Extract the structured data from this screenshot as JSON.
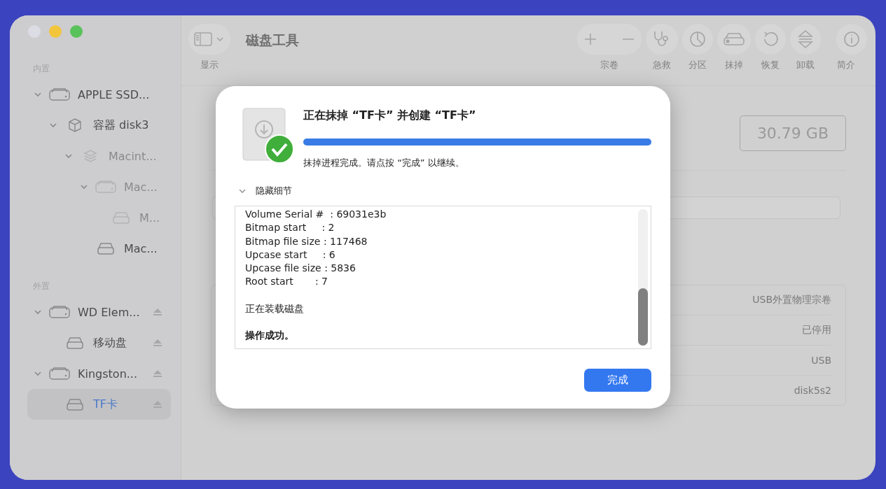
{
  "window": {
    "title": "磁盘工具"
  },
  "toolbar": {
    "view_button": {
      "label": "显示"
    },
    "buttons": [
      {
        "kind": "volume",
        "label": "宗卷"
      },
      {
        "kind": "first-aid",
        "label": "急救"
      },
      {
        "kind": "partition",
        "label": "分区"
      },
      {
        "kind": "erase",
        "label": "抹掉"
      },
      {
        "kind": "restore",
        "label": "恢复"
      },
      {
        "kind": "unmount",
        "label": "卸载"
      },
      {
        "kind": "info",
        "label": "简介"
      }
    ]
  },
  "sidebar": {
    "sections": [
      {
        "title": "内置",
        "items": [
          {
            "label": "APPLE SSD...",
            "kind": "drive",
            "greyed": false,
            "selected": false,
            "eject": false,
            "expanded": true,
            "children": [
              {
                "label": "容器 disk3",
                "kind": "container",
                "greyed": false,
                "selected": false,
                "eject": false,
                "expanded": true,
                "children": [
                  {
                    "label": "Macint...",
                    "kind": "stack",
                    "greyed": true,
                    "selected": false,
                    "eject": false,
                    "expanded": true,
                    "children": [
                      {
                        "label": "Mac...",
                        "kind": "drive",
                        "greyed": true,
                        "selected": false,
                        "eject": false,
                        "expanded": true,
                        "children": [
                          {
                            "label": "M...",
                            "kind": "volume",
                            "greyed": true,
                            "selected": false,
                            "eject": false
                          }
                        ]
                      },
                      {
                        "label": "Mac...",
                        "kind": "volume",
                        "greyed": false,
                        "selected": false,
                        "eject": false
                      }
                    ]
                  }
                ]
              }
            ]
          }
        ]
      },
      {
        "title": "外置",
        "items": [
          {
            "label": "WD Elem...",
            "kind": "drive",
            "greyed": false,
            "selected": false,
            "eject": true,
            "expanded": true,
            "children": [
              {
                "label": "移动盘",
                "kind": "volume",
                "greyed": false,
                "selected": false,
                "eject": true
              }
            ]
          },
          {
            "label": "Kingston...",
            "kind": "drive",
            "greyed": false,
            "selected": false,
            "eject": true,
            "expanded": true,
            "children": [
              {
                "label": "TF卡",
                "kind": "volume",
                "greyed": false,
                "selected": true,
                "eject": true
              }
            ]
          }
        ]
      }
    ]
  },
  "main": {
    "capacity": "30.79 GB",
    "info_rows": [
      {
        "column_2": "USB外置物理宗卷"
      },
      {
        "column_2": "已停用"
      },
      {
        "column_2": "USB"
      },
      {
        "column_2": "disk5s2"
      }
    ]
  },
  "dialog": {
    "title": "正在抹掉 “TF卡” 并创建 “TF卡”",
    "progress": {
      "level": 1
    },
    "message": "抹掉进程完成。请点按 “完成” 以继续。",
    "details": {
      "label": "隐藏细节",
      "expanded": true,
      "lines": [
        {
          "kind": "field",
          "text": "Volume Serial #  : 69031e3b"
        },
        {
          "kind": "field",
          "text": "Bitmap start     : 2"
        },
        {
          "kind": "field",
          "text": "Bitmap file size : 117468"
        },
        {
          "kind": "field",
          "text": "Upcase start     : 6"
        },
        {
          "kind": "field",
          "text": "Upcase file size : 5836"
        },
        {
          "kind": "field",
          "text": "Root start       : 7"
        },
        {
          "kind": "status",
          "text": "正在装载磁盘"
        },
        {
          "kind": "result",
          "text": "操作成功。"
        }
      ]
    },
    "button": "完成"
  }
}
